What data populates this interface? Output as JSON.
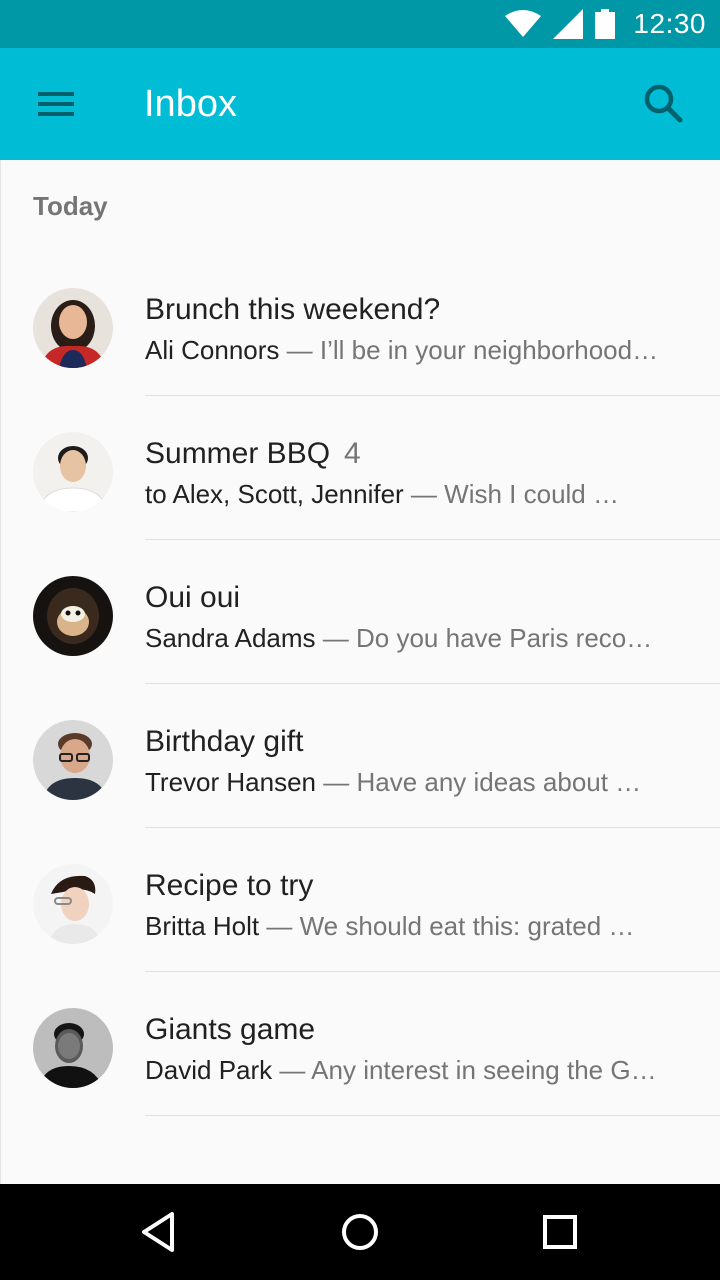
{
  "status_bar": {
    "time": "12:30",
    "icons": [
      "wifi-icon",
      "signal-icon",
      "battery-icon"
    ]
  },
  "app_bar": {
    "title": "Inbox",
    "icons": [
      "menu-icon",
      "search-icon"
    ],
    "color": "#00bcd4"
  },
  "section": {
    "header": "Today"
  },
  "messages": [
    {
      "subject": "Brunch this weekend?",
      "count": "",
      "sender": "Ali Connors",
      "separator": " — ",
      "preview": "I’ll be in your neighborhood…"
    },
    {
      "subject": "Summer BBQ",
      "count": "4",
      "sender": "to Alex, Scott, Jennifer",
      "separator": " — ",
      "preview": "Wish I could …"
    },
    {
      "subject": "Oui oui",
      "count": "",
      "sender": "Sandra Adams",
      "separator": " — ",
      "preview": "Do you have Paris reco…"
    },
    {
      "subject": "Birthday gift",
      "count": "",
      "sender": "Trevor Hansen",
      "separator": " — ",
      "preview": "Have any ideas about …"
    },
    {
      "subject": "Recipe to try",
      "count": "",
      "sender": "Britta Holt",
      "separator": " — ",
      "preview": "We should eat this: grated …"
    },
    {
      "subject": "Giants game",
      "count": "",
      "sender": "David Park",
      "separator": " — ",
      "preview": "Any interest in seeing the G…"
    }
  ],
  "nav_bar": {
    "icons": [
      "back-icon",
      "home-icon",
      "recents-icon"
    ]
  }
}
